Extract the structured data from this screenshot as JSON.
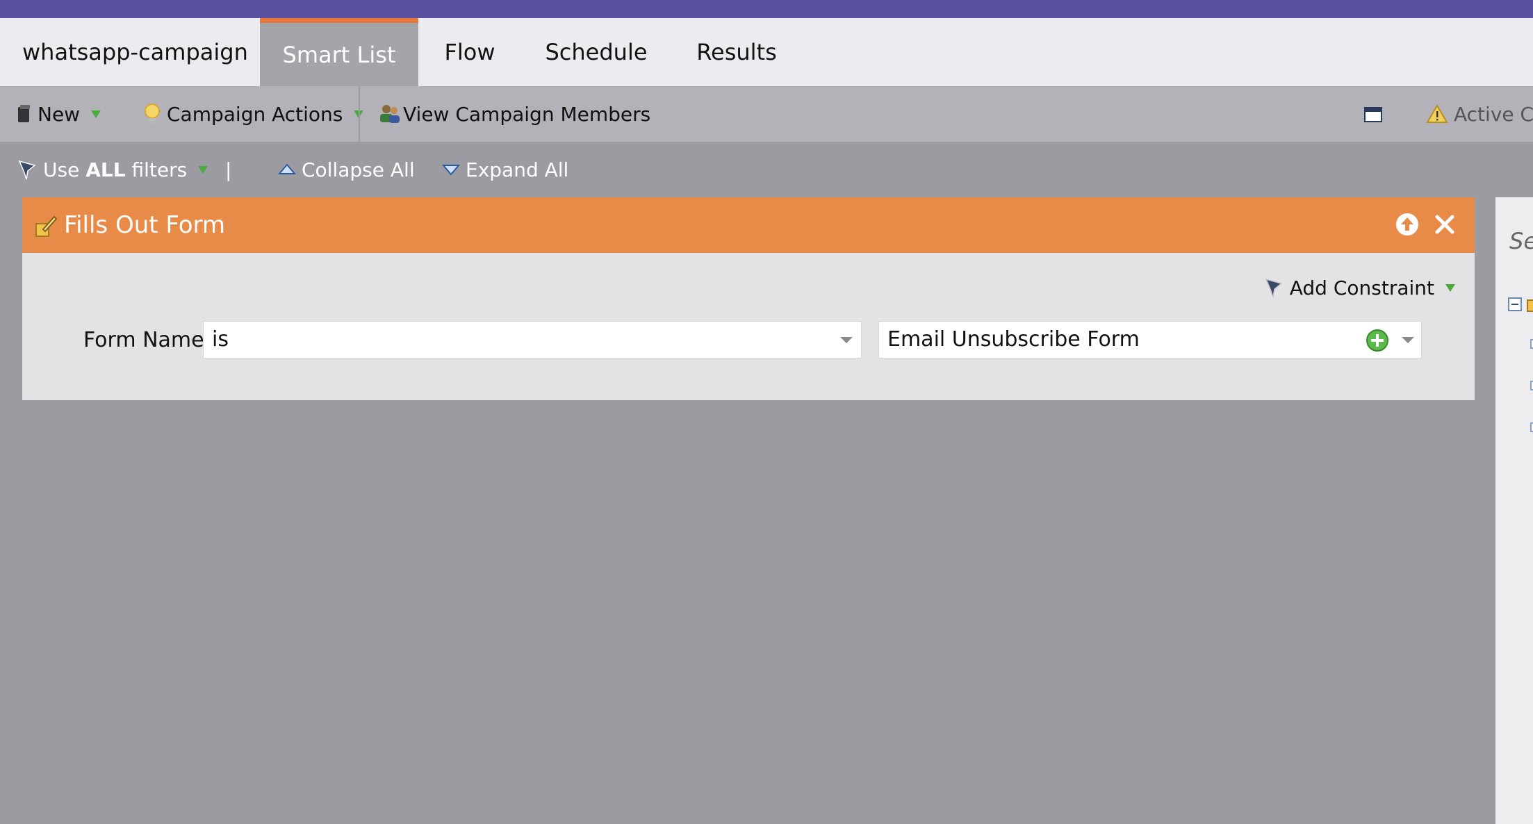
{
  "tabs": {
    "campaign": "whatsapp-campaign",
    "smart_list": "Smart List",
    "flow": "Flow",
    "schedule": "Schedule",
    "results": "Results"
  },
  "toolbar": {
    "new_label": "New",
    "campaign_actions_label": "Campaign Actions",
    "view_members_label": "View Campaign Members",
    "active_label": "Active Car"
  },
  "filters": {
    "use_prefix": "Use",
    "use_bold": "ALL",
    "use_suffix": "filters",
    "separator": "|",
    "collapse_label": "Collapse All",
    "expand_label": "Expand All"
  },
  "filter_panel": {
    "title": "Fills Out Form",
    "add_constraint_label": "Add Constraint",
    "form_name_label": "Form Name:",
    "operator_value": "is",
    "form_value": "Email Unsubscribe Form"
  },
  "right_panel": {
    "search_hint": "Se"
  },
  "colors": {
    "top_bar": "#5a52a1",
    "active_tab_accent": "#e8773a",
    "panel_header": "#e98b48",
    "background": "#9b9ba1"
  }
}
